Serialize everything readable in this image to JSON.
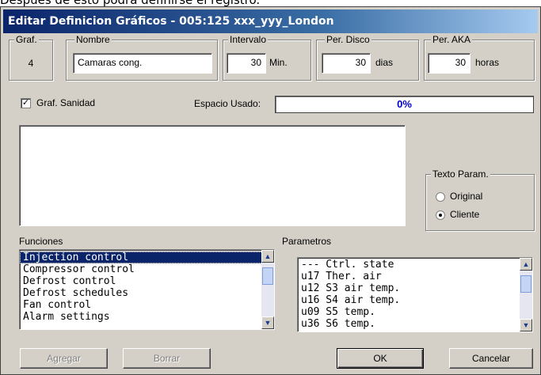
{
  "background_text": "Después de esto podrá definirse el registro.",
  "window": {
    "title": "Editar Definicion Gráficos - 005:125  xxx_yyy_London"
  },
  "graf": {
    "label": "Graf.",
    "value": "4"
  },
  "nombre": {
    "label": "Nombre",
    "value": "Camaras cong."
  },
  "intervalo": {
    "label": "Intervalo",
    "value": "30",
    "unit": "Min."
  },
  "per_disco": {
    "label": "Per. Disco",
    "value": "30",
    "unit": "dias"
  },
  "per_aka": {
    "label": "Per. AKA",
    "value": "30",
    "unit": "horas"
  },
  "graf_sanidad": {
    "label": "Graf. Sanidad",
    "checked": true
  },
  "espacio": {
    "label": "Espacio Usado:",
    "value": "0%"
  },
  "texto_param": {
    "label": "Texto Param.",
    "options": [
      {
        "label": "Original",
        "selected": false
      },
      {
        "label": "Cliente",
        "selected": true
      }
    ]
  },
  "funciones": {
    "label": "Funciones",
    "items": [
      "Injection control",
      "Compressor control",
      "Defrost control",
      "Defrost schedules",
      "Fan control",
      "Alarm settings"
    ],
    "selected_index": 0
  },
  "parametros": {
    "label": "Parametros",
    "items": [
      "--- Ctrl. state",
      "u17 Ther. air",
      "u12 S3 air temp.",
      "u16 S4 air temp.",
      "u09 S5 temp.",
      "u36 S6 temp."
    ]
  },
  "buttons": {
    "agregar": "Agregar",
    "borrar": "Borrar",
    "ok": "OK",
    "cancelar": "Cancelar"
  },
  "colors": {
    "title_start": "#0a246a",
    "title_end": "#a6caf0",
    "face": "#d4d0c8",
    "progress_text": "#0000cc",
    "selection": "#0a246a"
  }
}
